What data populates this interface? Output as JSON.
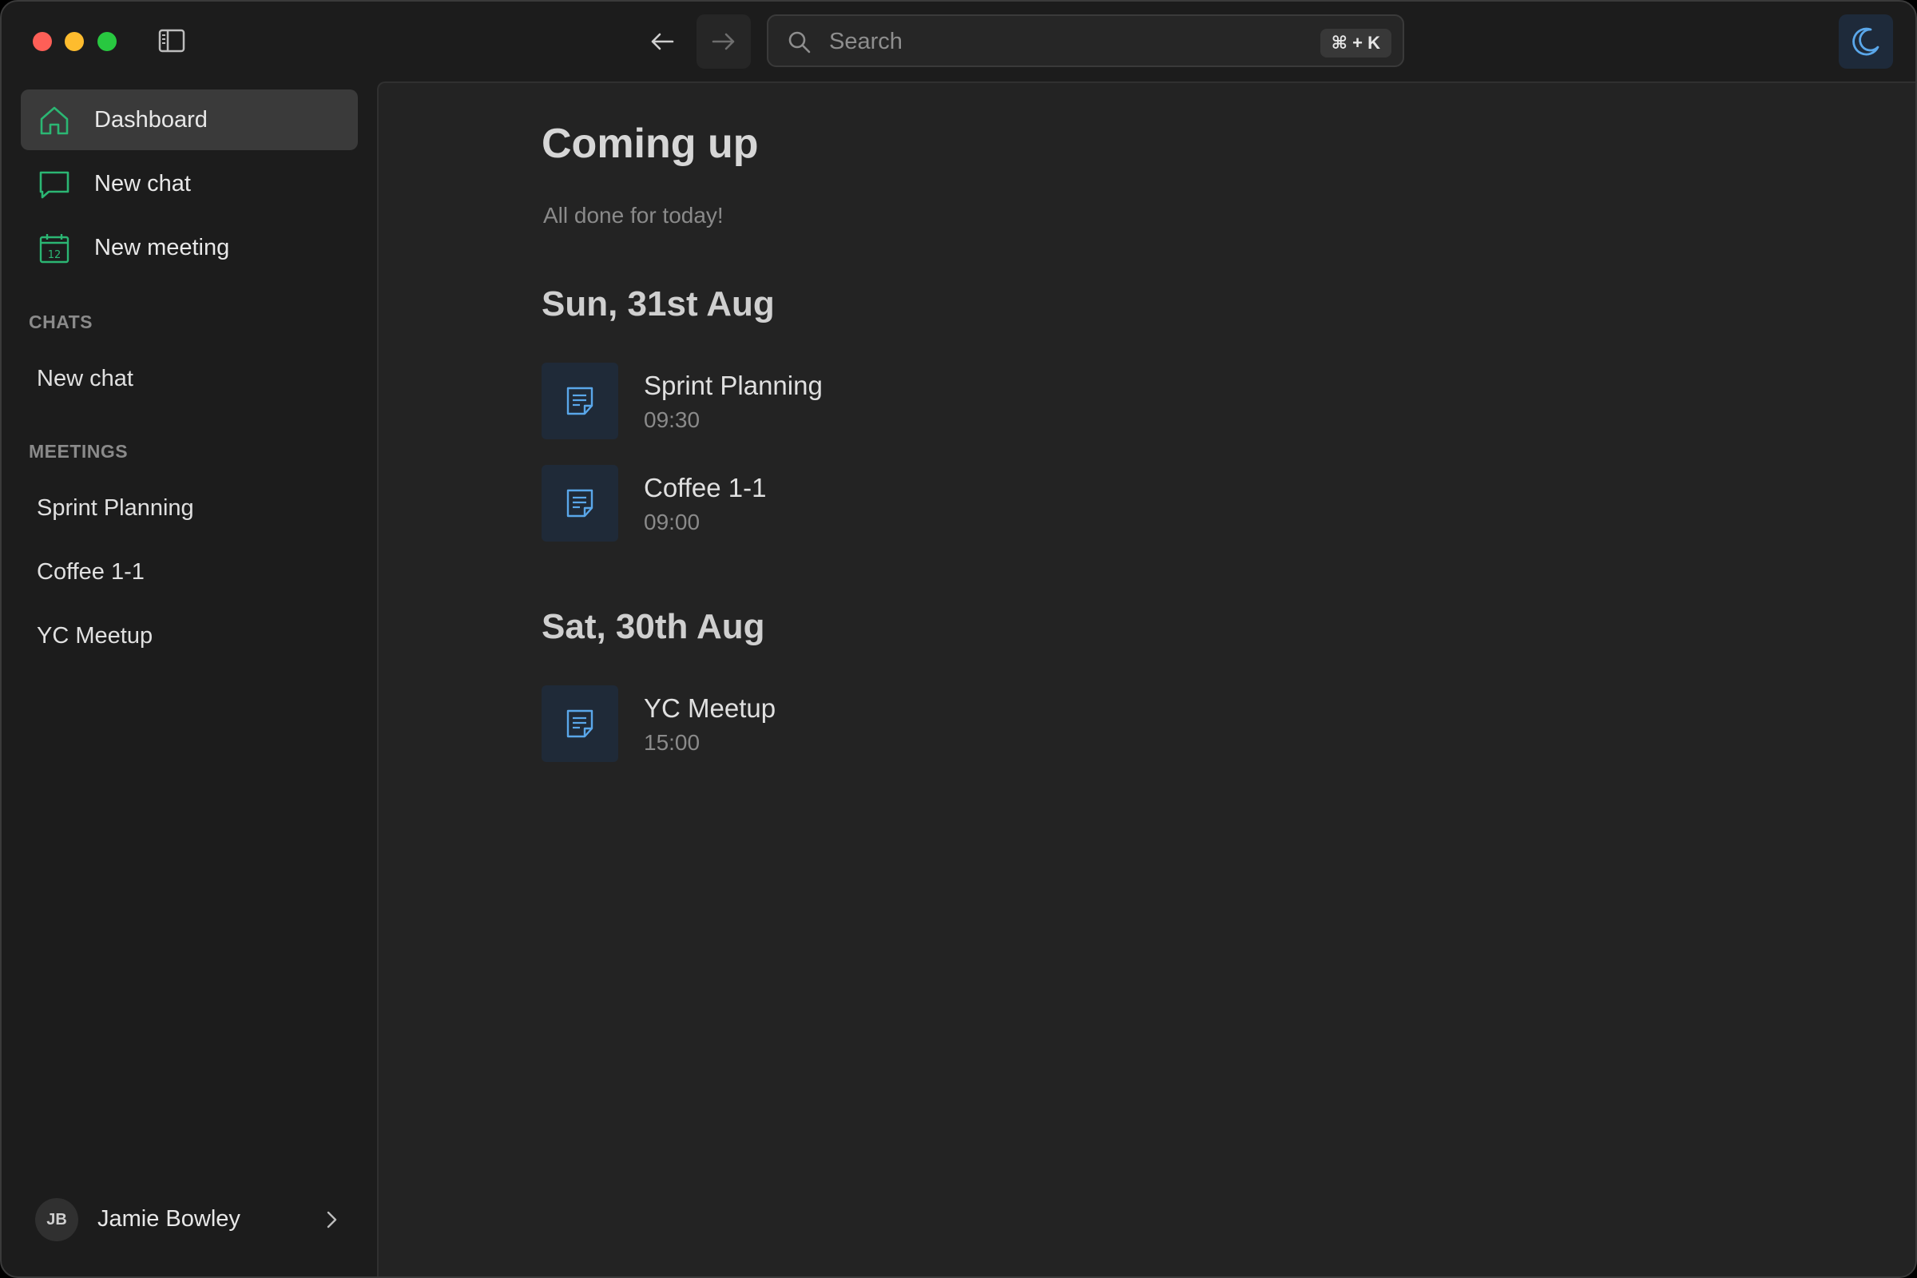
{
  "colors": {
    "accent_green": "#2bb673",
    "accent_blue": "#5aa7ea",
    "window_bg": "#1c1c1c",
    "main_bg": "#232323",
    "active_item_bg": "#3a3a3a"
  },
  "titlebar": {
    "search_placeholder": "Search",
    "search_shortcut": "⌘ + K",
    "icons": [
      "sidebar-toggle-icon",
      "arrow-left-icon",
      "arrow-right-icon",
      "search-icon",
      "moon-icon"
    ]
  },
  "sidebar": {
    "primary": [
      {
        "label": "Dashboard",
        "icon": "home-icon",
        "active": true
      },
      {
        "label": "New chat",
        "icon": "chat-bubble-icon",
        "active": false
      },
      {
        "label": "New meeting",
        "icon": "calendar-icon",
        "active": false
      }
    ],
    "chats_header": "CHATS",
    "chats": [
      "New chat"
    ],
    "meetings_header": "MEETINGS",
    "meetings": [
      "Sprint Planning",
      "Coffee 1-1",
      "YC Meetup"
    ],
    "user": {
      "initials": "JB",
      "name": "Jamie Bowley"
    }
  },
  "main": {
    "title": "Coming up",
    "status": "All done for today!",
    "days": [
      {
        "heading": "Sun, 31st Aug",
        "meetings": [
          {
            "title": "Sprint Planning",
            "time": "09:30"
          },
          {
            "title": "Coffee 1-1",
            "time": "09:00"
          }
        ]
      },
      {
        "heading": "Sat, 30th Aug",
        "meetings": [
          {
            "title": "YC Meetup",
            "time": "15:00"
          }
        ]
      }
    ]
  }
}
